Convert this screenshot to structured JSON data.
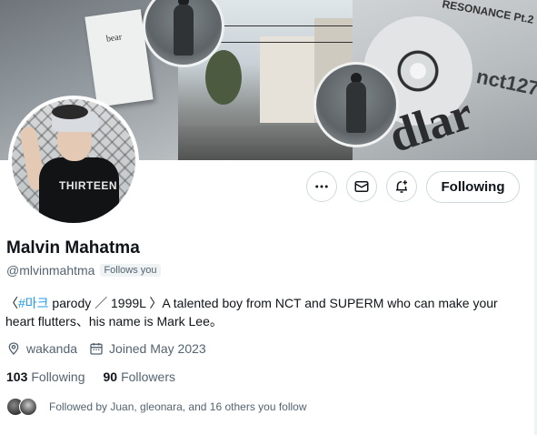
{
  "banner": {
    "book_label": "bear",
    "album_title": "RESONANCE Pt.2",
    "album_brand": "nct127",
    "album_big_text": "dlar"
  },
  "avatar": {
    "shirt_text": "THIRTEEN"
  },
  "actions": {
    "following_label": "Following"
  },
  "profile": {
    "name": "Malvin Mahatma",
    "handle": "@mlvinmahtma",
    "follows_you": "Follows you",
    "bio_prefix": "〈",
    "bio_hashtag": "#마크",
    "bio_rest": " parody ／ 1999L 〉A talented boy from NCT and SUPERM who can make your heart flutters、his name is Mark Lee。",
    "location": "wakanda",
    "joined": "Joined May 2023",
    "following_count": "103",
    "following_label": "Following",
    "followers_count": "90",
    "followers_label": "Followers",
    "followed_by": "Followed by Juan, gleonara, and 16 others you follow"
  },
  "colors": {
    "link": "#1d9bf0",
    "secondary_text": "#536471",
    "border": "#cfd9de"
  },
  "icons": {
    "more": "more-horizontal-icon",
    "message": "envelope-icon",
    "notify": "bell-plus-icon",
    "location": "location-pin-icon",
    "calendar": "calendar-icon"
  }
}
